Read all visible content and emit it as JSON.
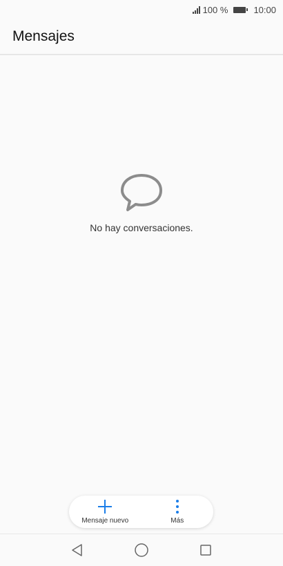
{
  "status_bar": {
    "battery_percent": "100 %",
    "time": "10:00",
    "icons": [
      "signal-icon",
      "battery-icon"
    ]
  },
  "header": {
    "title": "Mensajes"
  },
  "empty_state": {
    "icon": "chat-bubble-icon",
    "text": "No hay conversaciones."
  },
  "actions": {
    "new_message": {
      "label": "Mensaje nuevo",
      "icon": "plus-icon",
      "color": "#1a7de8"
    },
    "more": {
      "label": "Más",
      "icon": "more-vertical-icon",
      "color": "#1a7de8"
    }
  },
  "nav": {
    "icons": [
      "back-icon",
      "home-icon",
      "recents-icon"
    ]
  }
}
